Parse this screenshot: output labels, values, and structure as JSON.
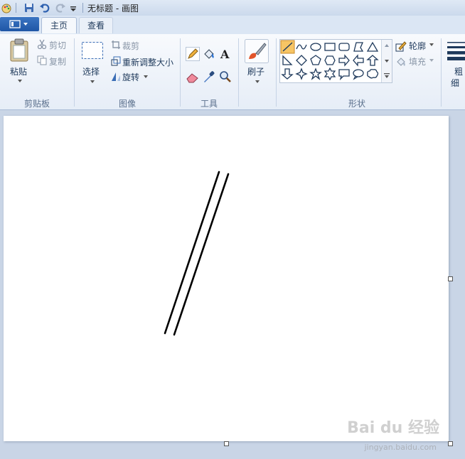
{
  "window": {
    "title": "无标题 - 画图"
  },
  "tabs": [
    {
      "label": "主页",
      "active": true
    },
    {
      "label": "查看",
      "active": false
    }
  ],
  "clipboard": {
    "paste_label": "粘贴",
    "cut_label": "剪切",
    "copy_label": "复制",
    "group_label": "剪贴板"
  },
  "image": {
    "select_label": "选择",
    "crop_label": "裁剪",
    "resize_label": "重新调整大小",
    "rotate_label": "旋转",
    "group_label": "图像"
  },
  "tools": {
    "group_label": "工具"
  },
  "brushes": {
    "label": "刷子"
  },
  "shapes": {
    "outline_label": "轮廓",
    "fill_label": "填充",
    "group_label": "形状"
  },
  "size": {
    "label_line1": "粗",
    "label_line2": "细"
  },
  "watermark": {
    "text": "Bai du 经验",
    "sub": "jingyan.baidu.com"
  },
  "colors": {
    "accent": "#1f56a6",
    "ribbon_bg": "#f2f6fb",
    "workspace": "#c9d5e6",
    "canvas": "#ffffff"
  }
}
